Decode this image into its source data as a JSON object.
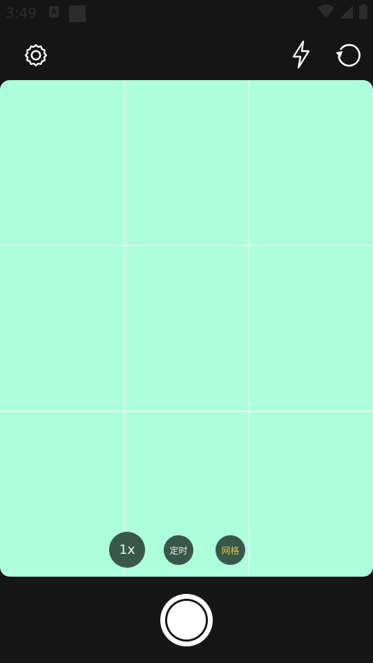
{
  "status_bar": {
    "time": "3:49",
    "left_icons": [
      "notification-a-icon",
      "notification-square-icon"
    ],
    "right_icons": [
      "wifi-icon",
      "cellular-signal-icon",
      "battery-icon"
    ]
  },
  "top_bar": {
    "settings_icon": "gear-icon",
    "flash_icon": "lightning-icon",
    "switch_camera_icon": "rotate-camera-icon"
  },
  "viewfinder": {
    "background_color": "#adfedb",
    "grid_color": "#ffffff",
    "grid_columns": 3,
    "grid_rows": 3
  },
  "controls": {
    "zoom_label": "1x",
    "timer_label": "定时",
    "grid_label": "网格",
    "grid_active_color": "#d9c24a"
  },
  "shutter": {
    "icon": "shutter-button-icon"
  }
}
